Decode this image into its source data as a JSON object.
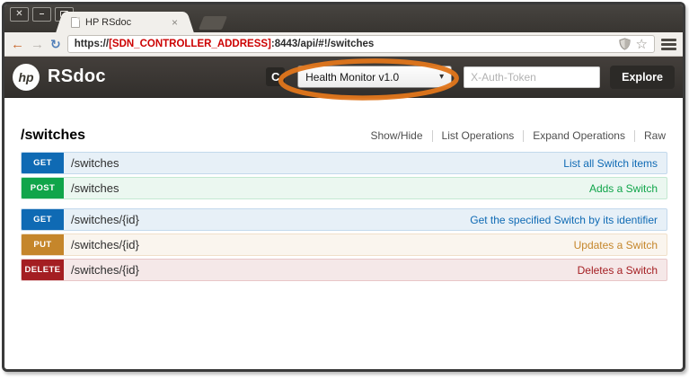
{
  "browser": {
    "tab_title": "HP RSdoc",
    "url": {
      "prefix": "https://",
      "address": "[SDN_CONTROLLER_ADDRESS]",
      "suffix": ":8443/api/#!/switches"
    }
  },
  "icons": {
    "close": "✕",
    "minimize": "–",
    "tab_close": "×",
    "back_arrow": "←",
    "forward_arrow": "→",
    "reload": "↻",
    "bookmark_star": "☆",
    "refresh": "C",
    "caret_down": "▾"
  },
  "header": {
    "logo_text": "hp",
    "brand": "RSdoc",
    "api_select_value": "Health Monitor v1.0",
    "token_placeholder": "X-Auth-Token",
    "explore_label": "Explore"
  },
  "annotation": {
    "shape": "ellipse",
    "color": "#e0761c",
    "target": "api-version-select"
  },
  "content": {
    "resource_title": "/switches",
    "ops_links": [
      "Show/Hide",
      "List Operations",
      "Expand Operations",
      "Raw"
    ],
    "endpoints": [
      {
        "method": "GET",
        "path": "/switches",
        "summary": "List all Switch items"
      },
      {
        "method": "POST",
        "path": "/switches",
        "summary": "Adds a Switch"
      },
      {
        "method": "GET",
        "path": "/switches/{id}",
        "summary": "Get the specified Switch by its identifier"
      },
      {
        "method": "PUT",
        "path": "/switches/{id}",
        "summary": "Updates a Switch"
      },
      {
        "method": "DELETE",
        "path": "/switches/{id}",
        "summary": "Deletes a Switch"
      }
    ],
    "method_styles": {
      "GET": {
        "badge": "#0f6ab4",
        "row_bg": "#e7f0f7",
        "row_border": "#c3d9ec",
        "link": "#0f6ab4"
      },
      "POST": {
        "badge": "#10a54a",
        "row_bg": "#ebf7f0",
        "row_border": "#c3e8d1",
        "link": "#10a54a"
      },
      "PUT": {
        "badge": "#c5862b",
        "row_bg": "#faf5ee",
        "row_border": "#f0e0ca",
        "link": "#c5862b"
      },
      "DELETE": {
        "badge": "#a41e22",
        "row_bg": "#f5e8e8",
        "row_border": "#e8c6c7",
        "link": "#a41e22"
      }
    }
  }
}
